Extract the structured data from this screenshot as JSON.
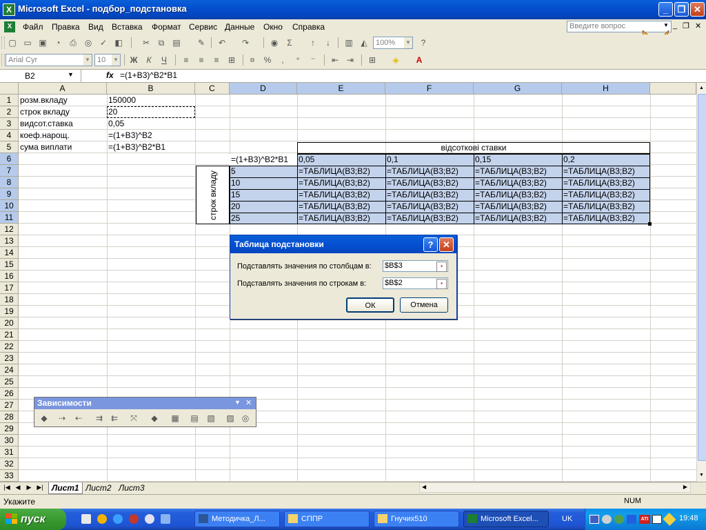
{
  "window": {
    "title": "Microsoft Excel - подбор_подстановка",
    "min": "_",
    "max": "❐",
    "close": "✕"
  },
  "menu": [
    "Файл",
    "Правка",
    "Вид",
    "Вставка",
    "Формат",
    "Сервис",
    "Данные",
    "Окно",
    "Справка"
  ],
  "ask_placeholder": "Введите вопрос",
  "toolbar": {
    "zoom": "100%",
    "font": "Arial Cyr",
    "size": "10",
    "bold": "Ж",
    "italic": "К",
    "underline": "Ч"
  },
  "namebox": "B2",
  "fx": "fx",
  "formula": "=(1+B3)^B2*B1",
  "columns": [
    "A",
    "B",
    "C",
    "D",
    "E",
    "F",
    "G",
    "H"
  ],
  "rows": [
    "1",
    "2",
    "3",
    "4",
    "5",
    "6",
    "7",
    "8",
    "9",
    "10",
    "11",
    "12",
    "13",
    "14",
    "15",
    "16",
    "17",
    "18",
    "19",
    "20",
    "21",
    "22",
    "23",
    "24",
    "25",
    "26",
    "27",
    "28",
    "29",
    "30",
    "31",
    "32",
    "33"
  ],
  "cells": {
    "A1": "розм.вкладу",
    "B1": "150000",
    "A2": "строк вкладу",
    "B2": "20",
    "A3": "видсот.ставка",
    "B3": "0,05",
    "A4": "коеф.нарощ.",
    "B4": "=(1+B3)^B2",
    "A5": "сума виплати",
    "B5": "=(1+B3)^B2*B1",
    "E5": "відсоткові ставки",
    "C_vertical": "строк вкладу",
    "D6": "=(1+B3)^B2*B1",
    "E6": "0,05",
    "F6": "0,1",
    "G6": "0,15",
    "H6": "0,2",
    "D7": "5",
    "D8": "10",
    "D9": "15",
    "D10": "20",
    "D11": "25",
    "table_formula": "=ТАБЛИЦА(B3;B2)"
  },
  "dialog": {
    "title": "Таблица подстановки",
    "help": "?",
    "close": "✕",
    "col_label": "Подставлять значения по столбцам в:",
    "col_value": "$B$3",
    "row_label": "Подставлять значения по строкам в:",
    "row_value": "$B$2",
    "ok": "ОК",
    "cancel": "Отмена"
  },
  "deps_toolbar": {
    "title": "Зависимости",
    "menu": "▼",
    "close": "✕"
  },
  "sheet_tabs": [
    "Лист1",
    "Лист2",
    "Лист3"
  ],
  "status": {
    "left": "Укажите",
    "num": "NUM"
  },
  "taskbar": {
    "start": "пуск",
    "tasks": [
      "Методичка_Л...",
      "СППР",
      "Гнучих510",
      "Microsoft Excel..."
    ],
    "lang": "UK",
    "clock": "19:48"
  },
  "colors": {
    "selection": "#c4d3ec",
    "titlebar": "#0450d0",
    "taskbar": "#245edb",
    "start": "#389a2f"
  }
}
